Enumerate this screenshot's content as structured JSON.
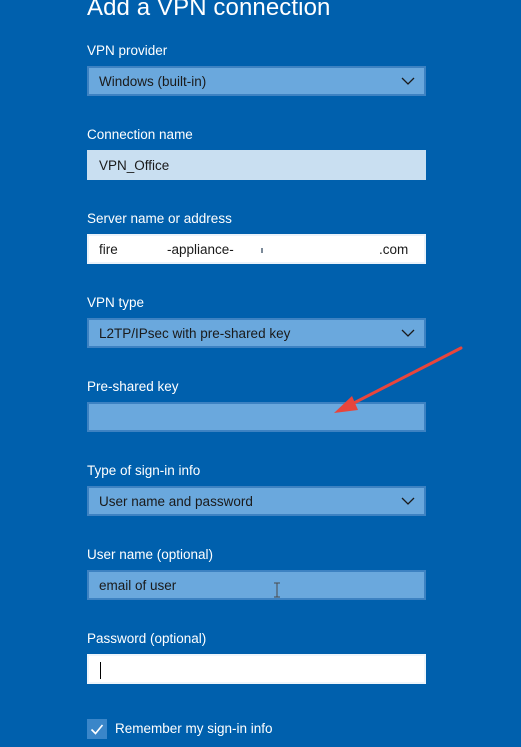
{
  "dialog": {
    "title": "Add a VPN connection"
  },
  "vpn_provider": {
    "label": "VPN provider",
    "value": "Windows (built-in)",
    "icon": "chevron-down-icon"
  },
  "connection_name": {
    "label": "Connection name",
    "value": "VPN_Office"
  },
  "server": {
    "label": "Server name or address",
    "value_part1": "fire",
    "value_part2": "-appliance-",
    "value_part3": ".com"
  },
  "vpn_type": {
    "label": "VPN type",
    "value": "L2TP/IPsec with pre-shared key",
    "icon": "chevron-down-icon"
  },
  "pre_shared_key": {
    "label": "Pre-shared key",
    "value": ""
  },
  "sign_in_type": {
    "label": "Type of sign-in info",
    "value": "User name and password",
    "icon": "chevron-down-icon"
  },
  "username": {
    "label": "User name (optional)",
    "value": "email of user"
  },
  "password": {
    "label": "Password (optional)",
    "value": ""
  },
  "remember": {
    "label": "Remember my sign-in info",
    "checked": true
  },
  "annotation": {
    "arrow_color": "#e8453c"
  },
  "colors": {
    "background": "#0060ad",
    "field_blue": "#6aa8dd",
    "field_light": "#c9dff1",
    "checkbox": "#3a86c9"
  }
}
